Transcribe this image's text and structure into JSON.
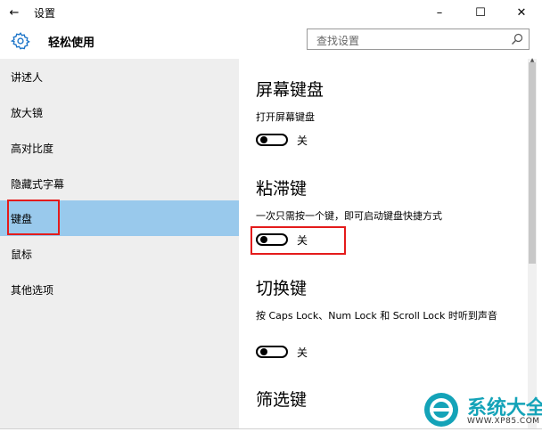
{
  "window": {
    "back_glyph": "←",
    "title": "设置",
    "controls": {
      "minimize": "–",
      "maximize": "☐",
      "close": "✕"
    }
  },
  "header": {
    "title": "轻松使用",
    "search_placeholder": "查找设置",
    "search_icon": "search-icon"
  },
  "sidebar": {
    "items": [
      {
        "label": "讲述人"
      },
      {
        "label": "放大镜"
      },
      {
        "label": "高对比度"
      },
      {
        "label": "隐藏式字幕"
      },
      {
        "label": "键盘",
        "selected": true
      },
      {
        "label": "鼠标"
      },
      {
        "label": "其他选项"
      }
    ]
  },
  "content": {
    "sections": [
      {
        "title": "屏幕键盘",
        "description": "打开屏幕键盘",
        "toggle_state": "关",
        "on": false
      },
      {
        "title": "粘滞键",
        "description": "一次只需按一个键，即可启动键盘快捷方式",
        "toggle_state": "关",
        "on": false
      },
      {
        "title": "切换键",
        "description": "按 Caps Lock、Num Lock 和 Scroll Lock 时听到声音",
        "toggle_state": "关",
        "on": false
      },
      {
        "title": "筛选键"
      }
    ]
  },
  "watermark": {
    "title": "系统大全",
    "url": "WWW.XP85.COM"
  },
  "colors": {
    "accent": "#1a73c8",
    "selected_bg": "#99c9ec",
    "sidebar_bg": "#eeeeee",
    "highlight_border": "#e41b1b",
    "watermark": "#14a3b8"
  }
}
